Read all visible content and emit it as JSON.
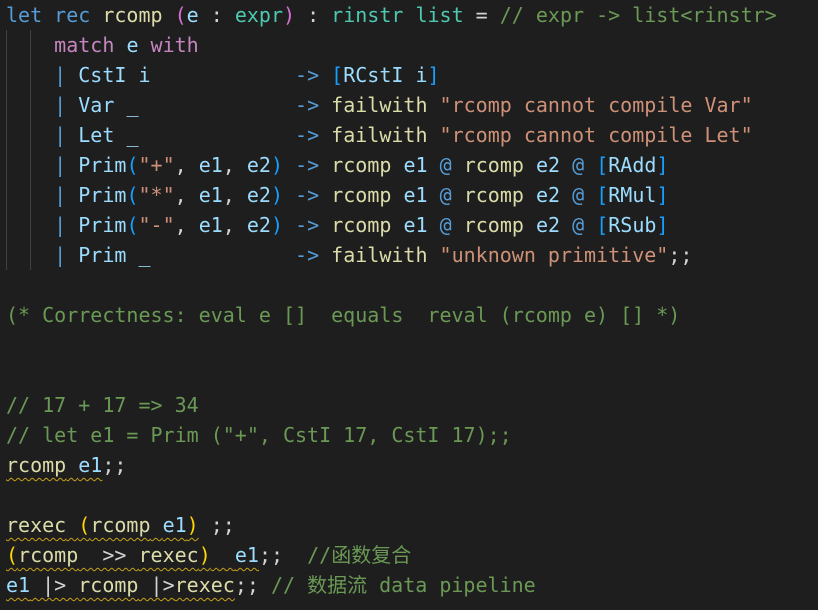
{
  "colors": {
    "background": "#1e1e1e",
    "keyword": "#569cd6",
    "control_keyword": "#c586c0",
    "identifier": "#9cdcfe",
    "function": "#dcdcaa",
    "type": "#4ec9b0",
    "string": "#ce9178",
    "comment": "#6a9955",
    "operator": "#d4d4d4",
    "bracket_gold": "#ffd700",
    "bracket_purple": "#da70d6",
    "bracket_blue": "#179fff",
    "squiggle": "#c8a21a"
  },
  "code_lines": [
    {
      "tokens": [
        {
          "t": "let",
          "c": "keyword"
        },
        {
          "t": " ",
          "c": "operator"
        },
        {
          "t": "rec",
          "c": "keyword"
        },
        {
          "t": " ",
          "c": "operator"
        },
        {
          "t": "rcomp",
          "c": "function"
        },
        {
          "t": " ",
          "c": "operator"
        },
        {
          "t": "(",
          "c": "bracket_purple"
        },
        {
          "t": "e",
          "c": "identifier"
        },
        {
          "t": " : ",
          "c": "operator"
        },
        {
          "t": "expr",
          "c": "type"
        },
        {
          "t": ")",
          "c": "bracket_purple"
        },
        {
          "t": " : ",
          "c": "operator"
        },
        {
          "t": "rinstr",
          "c": "type"
        },
        {
          "t": " ",
          "c": "operator"
        },
        {
          "t": "list",
          "c": "type"
        },
        {
          "t": " = ",
          "c": "operator"
        },
        {
          "t": "// expr -> list<rinstr>",
          "c": "comment"
        }
      ]
    },
    {
      "tokens": [
        {
          "t": "    ",
          "c": "operator"
        },
        {
          "t": "match",
          "c": "control_keyword"
        },
        {
          "t": " ",
          "c": "operator"
        },
        {
          "t": "e",
          "c": "identifier"
        },
        {
          "t": " ",
          "c": "operator"
        },
        {
          "t": "with",
          "c": "control_keyword"
        }
      ]
    },
    {
      "tokens": [
        {
          "t": "    ",
          "c": "operator"
        },
        {
          "t": "|",
          "c": "keyword"
        },
        {
          "t": " ",
          "c": "operator"
        },
        {
          "t": "CstI",
          "c": "identifier"
        },
        {
          "t": " ",
          "c": "operator"
        },
        {
          "t": "i",
          "c": "identifier"
        },
        {
          "t": "            ",
          "c": "operator"
        },
        {
          "t": "->",
          "c": "keyword"
        },
        {
          "t": " ",
          "c": "operator"
        },
        {
          "t": "[",
          "c": "bracket_blue"
        },
        {
          "t": "RCstI",
          "c": "identifier"
        },
        {
          "t": " ",
          "c": "operator"
        },
        {
          "t": "i",
          "c": "identifier"
        },
        {
          "t": "]",
          "c": "bracket_blue"
        }
      ]
    },
    {
      "tokens": [
        {
          "t": "    ",
          "c": "operator"
        },
        {
          "t": "|",
          "c": "keyword"
        },
        {
          "t": " ",
          "c": "operator"
        },
        {
          "t": "Var",
          "c": "identifier"
        },
        {
          "t": " ",
          "c": "operator"
        },
        {
          "t": "_",
          "c": "identifier"
        },
        {
          "t": "             ",
          "c": "operator"
        },
        {
          "t": "->",
          "c": "keyword"
        },
        {
          "t": " ",
          "c": "operator"
        },
        {
          "t": "failwith",
          "c": "function"
        },
        {
          "t": " ",
          "c": "operator"
        },
        {
          "t": "\"rcomp cannot compile Var\"",
          "c": "string"
        }
      ]
    },
    {
      "tokens": [
        {
          "t": "    ",
          "c": "operator"
        },
        {
          "t": "|",
          "c": "keyword"
        },
        {
          "t": " ",
          "c": "operator"
        },
        {
          "t": "Let",
          "c": "identifier"
        },
        {
          "t": " ",
          "c": "operator"
        },
        {
          "t": "_",
          "c": "identifier"
        },
        {
          "t": "             ",
          "c": "operator"
        },
        {
          "t": "->",
          "c": "keyword"
        },
        {
          "t": " ",
          "c": "operator"
        },
        {
          "t": "failwith",
          "c": "function"
        },
        {
          "t": " ",
          "c": "operator"
        },
        {
          "t": "\"rcomp cannot compile Let\"",
          "c": "string"
        }
      ]
    },
    {
      "tokens": [
        {
          "t": "    ",
          "c": "operator"
        },
        {
          "t": "|",
          "c": "keyword"
        },
        {
          "t": " ",
          "c": "operator"
        },
        {
          "t": "Prim",
          "c": "identifier"
        },
        {
          "t": "(",
          "c": "bracket_blue"
        },
        {
          "t": "\"+\"",
          "c": "string"
        },
        {
          "t": ", ",
          "c": "operator"
        },
        {
          "t": "e1",
          "c": "identifier"
        },
        {
          "t": ", ",
          "c": "operator"
        },
        {
          "t": "e2",
          "c": "identifier"
        },
        {
          "t": ")",
          "c": "bracket_blue"
        },
        {
          "t": " ",
          "c": "operator"
        },
        {
          "t": "->",
          "c": "keyword"
        },
        {
          "t": " ",
          "c": "operator"
        },
        {
          "t": "rcomp",
          "c": "function"
        },
        {
          "t": " ",
          "c": "operator"
        },
        {
          "t": "e1",
          "c": "identifier"
        },
        {
          "t": " ",
          "c": "operator"
        },
        {
          "t": "@",
          "c": "keyword"
        },
        {
          "t": " ",
          "c": "operator"
        },
        {
          "t": "rcomp",
          "c": "function"
        },
        {
          "t": " ",
          "c": "operator"
        },
        {
          "t": "e2",
          "c": "identifier"
        },
        {
          "t": " ",
          "c": "operator"
        },
        {
          "t": "@",
          "c": "keyword"
        },
        {
          "t": " ",
          "c": "operator"
        },
        {
          "t": "[",
          "c": "bracket_blue"
        },
        {
          "t": "RAdd",
          "c": "identifier"
        },
        {
          "t": "]",
          "c": "bracket_blue"
        }
      ]
    },
    {
      "tokens": [
        {
          "t": "    ",
          "c": "operator"
        },
        {
          "t": "|",
          "c": "keyword"
        },
        {
          "t": " ",
          "c": "operator"
        },
        {
          "t": "Prim",
          "c": "identifier"
        },
        {
          "t": "(",
          "c": "bracket_blue"
        },
        {
          "t": "\"*\"",
          "c": "string"
        },
        {
          "t": ", ",
          "c": "operator"
        },
        {
          "t": "e1",
          "c": "identifier"
        },
        {
          "t": ", ",
          "c": "operator"
        },
        {
          "t": "e2",
          "c": "identifier"
        },
        {
          "t": ")",
          "c": "bracket_blue"
        },
        {
          "t": " ",
          "c": "operator"
        },
        {
          "t": "->",
          "c": "keyword"
        },
        {
          "t": " ",
          "c": "operator"
        },
        {
          "t": "rcomp",
          "c": "function"
        },
        {
          "t": " ",
          "c": "operator"
        },
        {
          "t": "e1",
          "c": "identifier"
        },
        {
          "t": " ",
          "c": "operator"
        },
        {
          "t": "@",
          "c": "keyword"
        },
        {
          "t": " ",
          "c": "operator"
        },
        {
          "t": "rcomp",
          "c": "function"
        },
        {
          "t": " ",
          "c": "operator"
        },
        {
          "t": "e2",
          "c": "identifier"
        },
        {
          "t": " ",
          "c": "operator"
        },
        {
          "t": "@",
          "c": "keyword"
        },
        {
          "t": " ",
          "c": "operator"
        },
        {
          "t": "[",
          "c": "bracket_blue"
        },
        {
          "t": "RMul",
          "c": "identifier"
        },
        {
          "t": "]",
          "c": "bracket_blue"
        }
      ]
    },
    {
      "tokens": [
        {
          "t": "    ",
          "c": "operator"
        },
        {
          "t": "|",
          "c": "keyword"
        },
        {
          "t": " ",
          "c": "operator"
        },
        {
          "t": "Prim",
          "c": "identifier"
        },
        {
          "t": "(",
          "c": "bracket_blue"
        },
        {
          "t": "\"-\"",
          "c": "string"
        },
        {
          "t": ", ",
          "c": "operator"
        },
        {
          "t": "e1",
          "c": "identifier"
        },
        {
          "t": ", ",
          "c": "operator"
        },
        {
          "t": "e2",
          "c": "identifier"
        },
        {
          "t": ")",
          "c": "bracket_blue"
        },
        {
          "t": " ",
          "c": "operator"
        },
        {
          "t": "->",
          "c": "keyword"
        },
        {
          "t": " ",
          "c": "operator"
        },
        {
          "t": "rcomp",
          "c": "function"
        },
        {
          "t": " ",
          "c": "operator"
        },
        {
          "t": "e1",
          "c": "identifier"
        },
        {
          "t": " ",
          "c": "operator"
        },
        {
          "t": "@",
          "c": "keyword"
        },
        {
          "t": " ",
          "c": "operator"
        },
        {
          "t": "rcomp",
          "c": "function"
        },
        {
          "t": " ",
          "c": "operator"
        },
        {
          "t": "e2",
          "c": "identifier"
        },
        {
          "t": " ",
          "c": "operator"
        },
        {
          "t": "@",
          "c": "keyword"
        },
        {
          "t": " ",
          "c": "operator"
        },
        {
          "t": "[",
          "c": "bracket_blue"
        },
        {
          "t": "RSub",
          "c": "identifier"
        },
        {
          "t": "]",
          "c": "bracket_blue"
        }
      ]
    },
    {
      "tokens": [
        {
          "t": "    ",
          "c": "operator"
        },
        {
          "t": "|",
          "c": "keyword"
        },
        {
          "t": " ",
          "c": "operator"
        },
        {
          "t": "Prim",
          "c": "identifier"
        },
        {
          "t": " ",
          "c": "operator"
        },
        {
          "t": "_",
          "c": "identifier"
        },
        {
          "t": "            ",
          "c": "operator"
        },
        {
          "t": "->",
          "c": "keyword"
        },
        {
          "t": " ",
          "c": "operator"
        },
        {
          "t": "failwith",
          "c": "function"
        },
        {
          "t": " ",
          "c": "operator"
        },
        {
          "t": "\"unknown primitive\"",
          "c": "string"
        },
        {
          "t": ";;",
          "c": "operator"
        }
      ]
    },
    {
      "tokens": []
    },
    {
      "tokens": [
        {
          "t": "(* Correctness: eval e []  equals  reval (rcomp e) [] *)",
          "c": "comment"
        }
      ]
    },
    {
      "tokens": []
    },
    {
      "tokens": []
    },
    {
      "tokens": [
        {
          "t": "// 17 + 17 => 34",
          "c": "comment"
        }
      ]
    },
    {
      "tokens": [
        {
          "t": "// let e1 = Prim (\"+\", CstI 17, CstI 17);;",
          "c": "comment"
        }
      ]
    },
    {
      "tokens": [
        {
          "t": "rcomp",
          "c": "function",
          "sq": true
        },
        {
          "t": " ",
          "c": "operator",
          "sq": true
        },
        {
          "t": "e1",
          "c": "identifier",
          "sq": true
        },
        {
          "t": ";;",
          "c": "operator"
        }
      ]
    },
    {
      "tokens": []
    },
    {
      "tokens": [
        {
          "t": "rexec",
          "c": "function",
          "sq": true
        },
        {
          "t": " ",
          "c": "operator",
          "sq": true
        },
        {
          "t": "(",
          "c": "bracket_gold",
          "sq": true
        },
        {
          "t": "rcomp",
          "c": "function",
          "sq": true
        },
        {
          "t": " ",
          "c": "operator",
          "sq": true
        },
        {
          "t": "e1",
          "c": "identifier",
          "sq": true
        },
        {
          "t": ")",
          "c": "bracket_gold",
          "sq": true
        },
        {
          "t": " ;;",
          "c": "operator"
        }
      ]
    },
    {
      "tokens": [
        {
          "t": "(",
          "c": "bracket_gold",
          "sq": true
        },
        {
          "t": "rcomp",
          "c": "function",
          "sq": true
        },
        {
          "t": "  >> ",
          "c": "operator",
          "sq": true
        },
        {
          "t": "rexec",
          "c": "function",
          "sq": true
        },
        {
          "t": ")",
          "c": "bracket_gold",
          "sq": true
        },
        {
          "t": "  ",
          "c": "operator",
          "sq": true
        },
        {
          "t": "e1",
          "c": "identifier",
          "sq": true
        },
        {
          "t": ";;  ",
          "c": "operator"
        },
        {
          "t": "//函数复合",
          "c": "comment"
        }
      ]
    },
    {
      "tokens": [
        {
          "t": "e1",
          "c": "identifier",
          "sq": true
        },
        {
          "t": " |> ",
          "c": "operator",
          "sq": true
        },
        {
          "t": "rcomp",
          "c": "function",
          "sq": true
        },
        {
          "t": " |>",
          "c": "operator",
          "sq": true
        },
        {
          "t": "rexec",
          "c": "function",
          "sq": true
        },
        {
          "t": ";; ",
          "c": "operator"
        },
        {
          "t": "// 数据流 data pipeline",
          "c": "comment"
        }
      ]
    }
  ]
}
